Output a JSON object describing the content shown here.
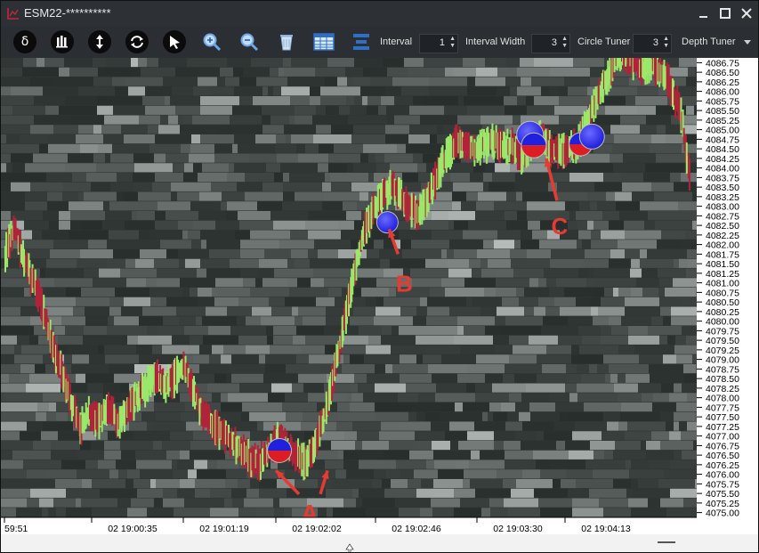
{
  "window": {
    "title": "ESM22-**********",
    "controls": [
      "minimize",
      "maximize",
      "close"
    ]
  },
  "toolbar": {
    "tools": [
      {
        "name": "delta",
        "glyph": "δ"
      },
      {
        "name": "bars",
        "glyph": ""
      },
      {
        "name": "vertical-scale",
        "glyph": ""
      },
      {
        "name": "refresh",
        "glyph": ""
      },
      {
        "name": "cursor",
        "glyph": ""
      },
      {
        "name": "zoom-in",
        "glyph": ""
      },
      {
        "name": "zoom-out",
        "glyph": ""
      },
      {
        "name": "clear",
        "glyph": ""
      },
      {
        "name": "grid",
        "glyph": ""
      },
      {
        "name": "layers",
        "glyph": ""
      }
    ],
    "interval_label": "Interval",
    "interval_value": "1",
    "interval_width_label": "Interval Width",
    "interval_width_value": "3",
    "circle_tuner_label": "Circle Tuner",
    "circle_tuner_value": "3",
    "depth_tuner_label": "Depth Tuner"
  },
  "chart_data": {
    "type": "heatmap",
    "price_ticks": [
      "4086.75",
      "4086.50",
      "4086.25",
      "4086.00",
      "4085.75",
      "4085.50",
      "4085.25",
      "4085.00",
      "4084.75",
      "4084.50",
      "4084.25",
      "4084.00",
      "4083.75",
      "4083.50",
      "4083.25",
      "4083.00",
      "4082.75",
      "4082.50",
      "4082.25",
      "4082.00",
      "4081.75",
      "4081.50",
      "4081.25",
      "4081.00",
      "4080.75",
      "4080.50",
      "4080.25",
      "4080.00",
      "4079.75",
      "4079.50",
      "4079.25",
      "4079.00",
      "4078.75",
      "4078.50",
      "4078.25",
      "4078.00",
      "4077.75",
      "4077.50",
      "4077.25",
      "4077.00",
      "4076.75",
      "4076.50",
      "4076.25",
      "4076.00",
      "4075.75",
      "4075.50",
      "4075.25",
      "4075.00"
    ],
    "ylim": [
      4075.0,
      4086.75
    ],
    "time_ticks": [
      "59:51",
      "02 19:00:35",
      "02 19:01:19",
      "02 19:02:02",
      "02 19:02:46",
      "02 19:03:30",
      "02 19:04:13"
    ],
    "price_path": [
      [
        0,
        4081.8
      ],
      [
        1,
        4082.4
      ],
      [
        2,
        4081.6
      ],
      [
        3,
        4081.0
      ],
      [
        4,
        4080.3
      ],
      [
        5,
        4079.4
      ],
      [
        6,
        4078.7
      ],
      [
        7,
        4077.9
      ],
      [
        8,
        4077.2
      ],
      [
        9,
        4077.6
      ],
      [
        10,
        4077.4
      ],
      [
        11,
        4077.8
      ],
      [
        12,
        4077.3
      ],
      [
        13,
        4077.7
      ],
      [
        14,
        4078.0
      ],
      [
        15,
        4078.3
      ],
      [
        16,
        4078.6
      ],
      [
        17,
        4078.3
      ],
      [
        18,
        4078.5
      ],
      [
        19,
        4078.9
      ],
      [
        20,
        4078.2
      ],
      [
        21,
        4077.6
      ],
      [
        22,
        4077.3
      ],
      [
        23,
        4077.1
      ],
      [
        24,
        4076.9
      ],
      [
        25,
        4076.7
      ],
      [
        26,
        4076.4
      ],
      [
        27,
        4076.3
      ],
      [
        28,
        4076.6
      ],
      [
        29,
        4076.9
      ],
      [
        30,
        4076.7
      ],
      [
        31,
        4076.5
      ],
      [
        32,
        4076.3
      ],
      [
        33,
        4076.8
      ],
      [
        34,
        4077.5
      ],
      [
        35,
        4078.6
      ],
      [
        36,
        4079.8
      ],
      [
        37,
        4081.0
      ],
      [
        38,
        4082.2
      ],
      [
        39,
        4082.8
      ],
      [
        40,
        4083.2
      ],
      [
        41,
        4083.5
      ],
      [
        42,
        4083.3
      ],
      [
        43,
        4083.0
      ],
      [
        44,
        4082.8
      ],
      [
        45,
        4083.2
      ],
      [
        46,
        4083.8
      ],
      [
        47,
        4084.3
      ],
      [
        48,
        4084.7
      ],
      [
        49,
        4084.6
      ],
      [
        50,
        4084.4
      ],
      [
        51,
        4084.6
      ],
      [
        52,
        4084.7
      ],
      [
        53,
        4084.5
      ],
      [
        54,
        4084.6
      ],
      [
        55,
        4084.3
      ],
      [
        56,
        4084.6
      ],
      [
        57,
        4084.8
      ],
      [
        58,
        4084.5
      ],
      [
        59,
        4084.4
      ],
      [
        60,
        4084.5
      ],
      [
        61,
        4084.6
      ],
      [
        62,
        4085.2
      ],
      [
        63,
        4085.8
      ],
      [
        64,
        4086.3
      ],
      [
        65,
        4086.9
      ],
      [
        66,
        4086.9
      ],
      [
        67,
        4086.8
      ],
      [
        68,
        4086.6
      ],
      [
        69,
        4086.7
      ],
      [
        70,
        4086.5
      ],
      [
        71,
        4086.1
      ],
      [
        72,
        4085.4
      ],
      [
        73,
        4083.6
      ]
    ],
    "circles": [
      {
        "t": 29.3,
        "price": 4076.62,
        "size": 1,
        "kind": "split"
      },
      {
        "t": 40.8,
        "price": 4082.58,
        "size": 0.7,
        "kind": "blue"
      },
      {
        "t": 56.0,
        "price": 4084.87,
        "size": 1.3,
        "kind": "blue"
      },
      {
        "t": 56.4,
        "price": 4084.59,
        "size": 1.1,
        "kind": "split"
      },
      {
        "t": 61.4,
        "price": 4084.62,
        "size": 0.9,
        "kind": "split"
      },
      {
        "t": 62.6,
        "price": 4084.82,
        "size": 1.1,
        "kind": "blue"
      }
    ],
    "annotations": [
      {
        "label": "A"
      },
      {
        "label": "B"
      },
      {
        "label": "C"
      }
    ],
    "colors": {
      "bid": "#dd1d24",
      "ask": "#2020dd",
      "up_bar": "#9be86a",
      "down_bar": "#b0243a",
      "annotation": "#e53b33"
    }
  }
}
